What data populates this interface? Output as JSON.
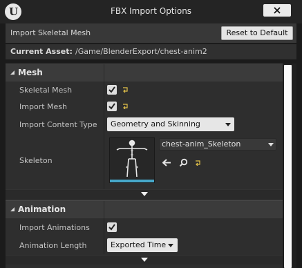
{
  "window": {
    "title": "FBX Import Options",
    "logo_letter": "U",
    "close_icon": "close-icon"
  },
  "toolbar": {
    "label": "Import Skeletal Mesh",
    "reset_label": "Reset to Default"
  },
  "asset": {
    "label": "Current Asset:",
    "path": "/Game/BlenderExport/chest-anim2"
  },
  "mesh": {
    "header": "Mesh",
    "skeletal_mesh": {
      "label": "Skeletal Mesh",
      "checked": true
    },
    "import_mesh": {
      "label": "Import Mesh",
      "checked": true
    },
    "import_content_type": {
      "label": "Import Content Type",
      "value": "Geometry and Skinning Weights."
    },
    "skeleton": {
      "label": "Skeleton",
      "value": "chest-anim_Skeleton",
      "icons": [
        "use-selected-arrow-icon",
        "browse-search-icon",
        "reset-arrow-icon"
      ]
    }
  },
  "animation": {
    "header": "Animation",
    "import_animations": {
      "label": "Import Animations",
      "checked": true
    },
    "animation_length": {
      "label": "Animation Length",
      "value": "Exported Time"
    }
  },
  "colors": {
    "accent_yellow": "#e3c24a",
    "thumbnail_strip": "#47a7c9",
    "background": "#2e2e2e"
  }
}
